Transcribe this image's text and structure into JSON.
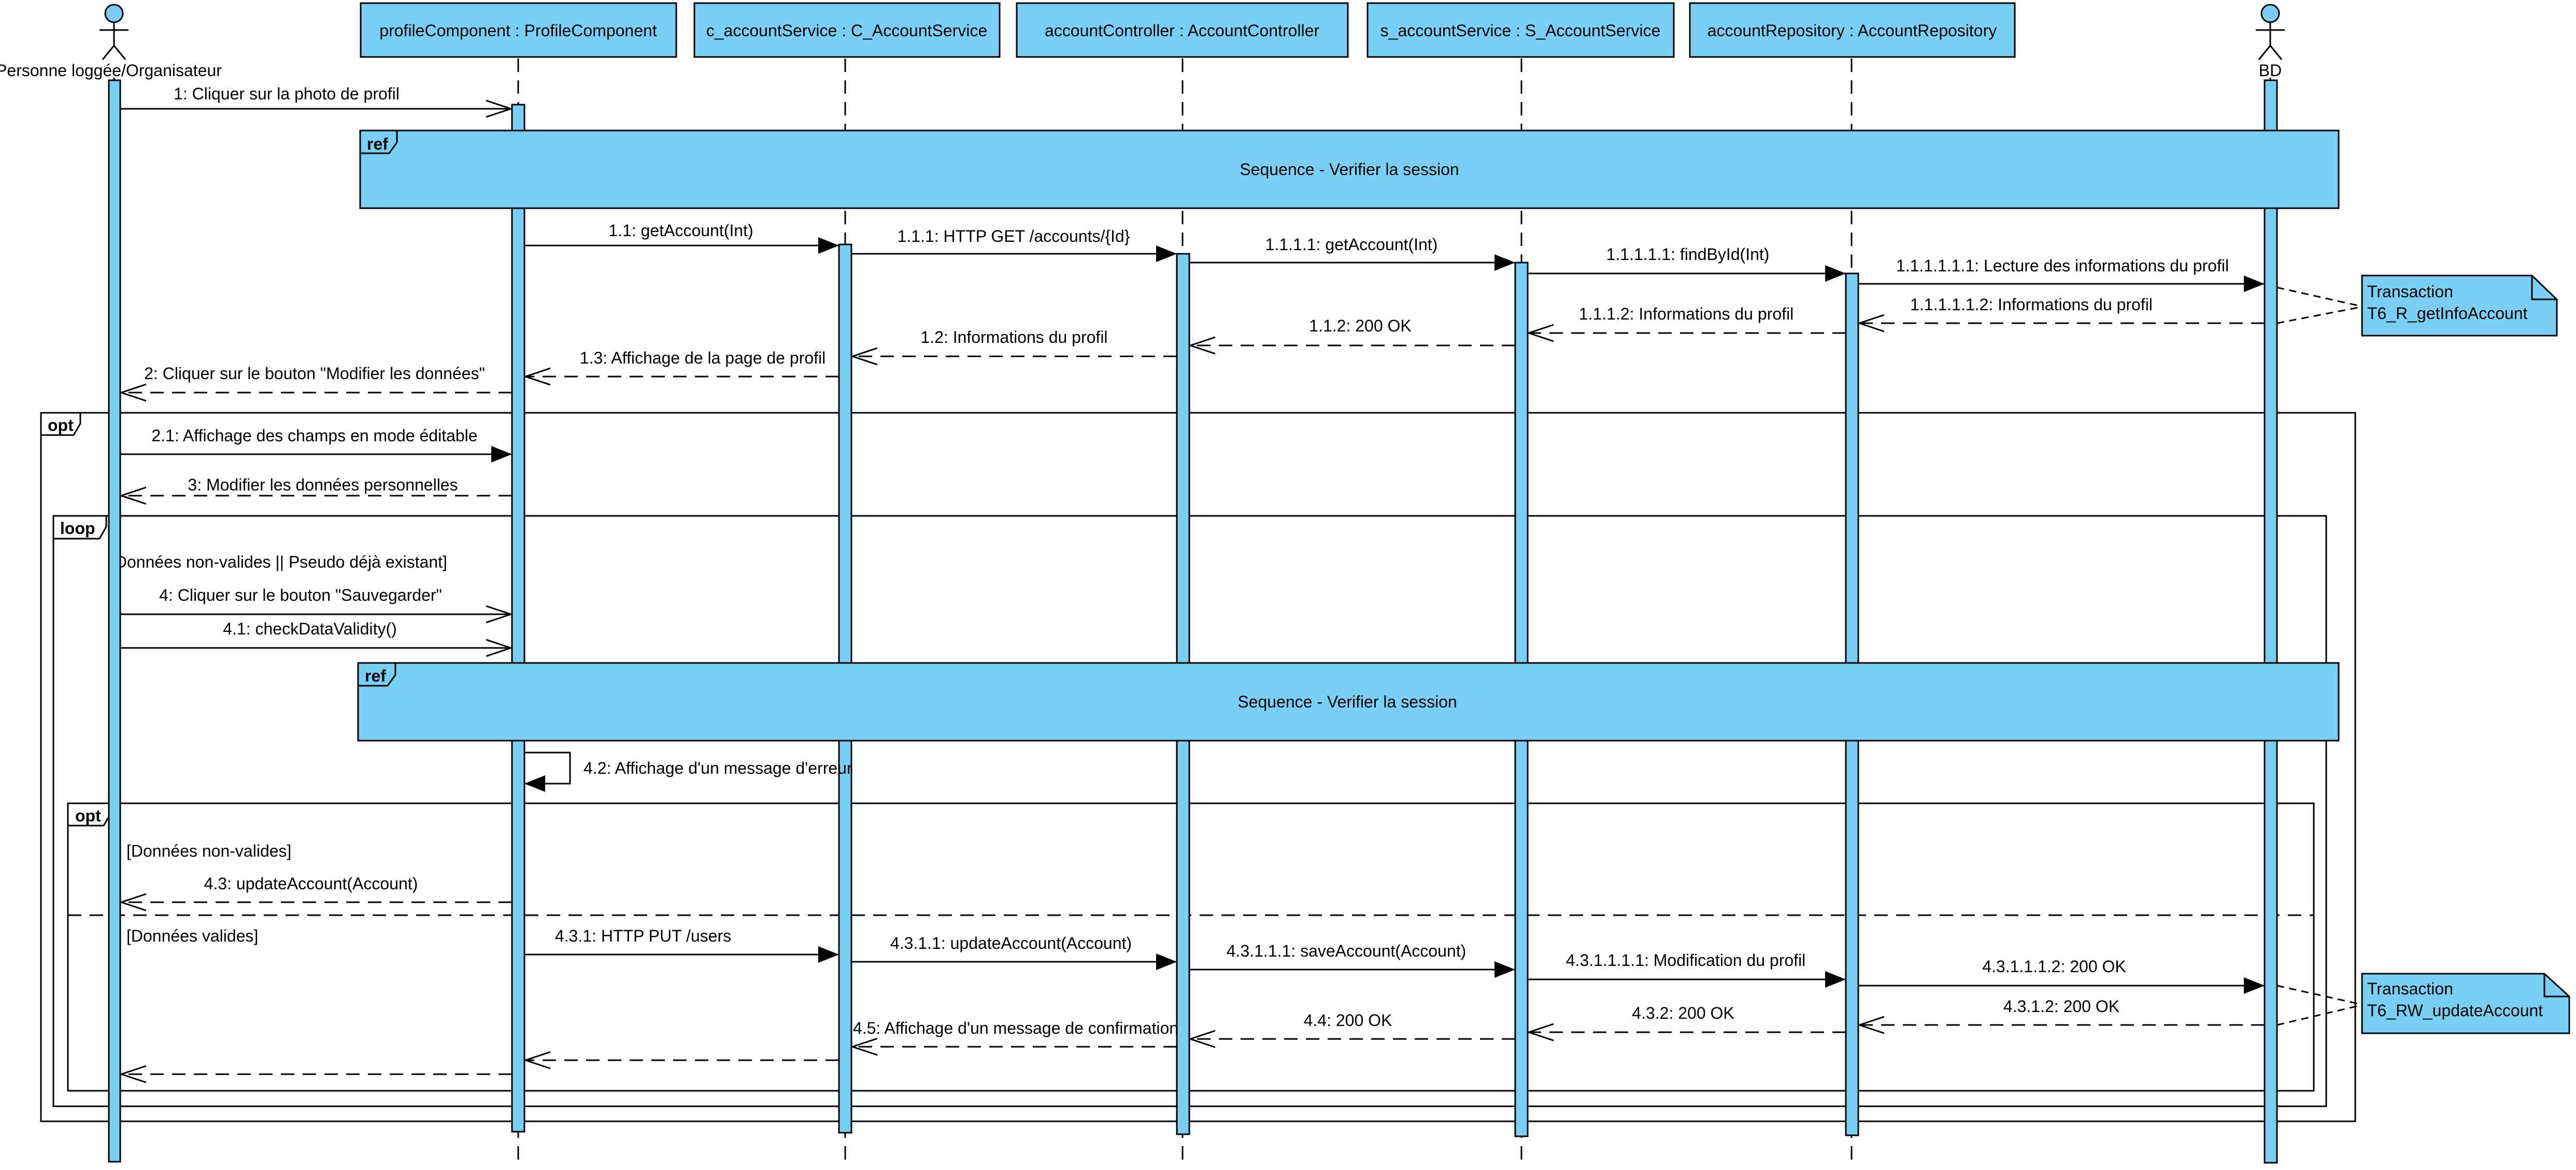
{
  "colors": {
    "fill": "#7acff5",
    "stroke": "#000000",
    "note_fill": "#7acff5",
    "background": "#ffffff"
  },
  "actors": [
    {
      "id": "user",
      "label": "Personne loggée/Organisateur",
      "kind": "actor"
    },
    {
      "id": "profile",
      "label": "profileComponent : ProfileComponent",
      "kind": "object"
    },
    {
      "id": "cservice",
      "label": "c_accountService : C_AccountService",
      "kind": "object"
    },
    {
      "id": "controller",
      "label": "accountController : AccountController",
      "kind": "object"
    },
    {
      "id": "sservice",
      "label": "s_accountService : S_AccountService",
      "kind": "object"
    },
    {
      "id": "repo",
      "label": "accountRepository : AccountRepository",
      "kind": "object"
    },
    {
      "id": "bd",
      "label": "BD",
      "kind": "actor"
    }
  ],
  "fragments": {
    "ref1": {
      "tag": "ref",
      "text": "Sequence - Verifier la session"
    },
    "ref2": {
      "tag": "ref",
      "text": "Sequence - Verifier la session"
    },
    "opt_outer": {
      "tag": "opt"
    },
    "loop": {
      "tag": "loop",
      "guard": "[Données non-valides || Pseudo déjà existant]"
    },
    "opt_inner": {
      "tag": "opt",
      "guard1": "[Données non-valides]",
      "guard2": "[Données valides]"
    }
  },
  "notes": [
    {
      "id": "note1",
      "line1": "Transaction",
      "line2": "T6_R_getInfoAccount"
    },
    {
      "id": "note2",
      "line1": "Transaction",
      "line2": "T6_RW_updateAccount"
    }
  ],
  "messages": [
    {
      "id": "m1",
      "label": "1: Cliquer sur la photo de profil"
    },
    {
      "id": "m1_1",
      "label": "1.1: getAccount(Int)"
    },
    {
      "id": "m1_1_1",
      "label": "1.1.1: HTTP GET /accounts/{Id}"
    },
    {
      "id": "m1_1_1_1",
      "label": "1.1.1.1: getAccount(Int)"
    },
    {
      "id": "m1_1_1_1_1",
      "label": "1.1.1.1.1: findById(Int)"
    },
    {
      "id": "m1_1_1_1_1_1",
      "label": "1.1.1.1.1.1: Lecture des informations du profil"
    },
    {
      "id": "m1_1_1_1_1_2",
      "label": "1.1.1.1.1.2: Informations du profil"
    },
    {
      "id": "m1_1_1_2",
      "label": "1.1.1.2: Informations du profil"
    },
    {
      "id": "m1_1_2",
      "label": "1.1.2: 200 OK"
    },
    {
      "id": "m1_2",
      "label": "1.2: Informations du profil"
    },
    {
      "id": "m1_3",
      "label": "1.3: Affichage de la page de profil"
    },
    {
      "id": "m2",
      "label": "2: Cliquer sur le bouton \"Modifier les données\""
    },
    {
      "id": "m2_1",
      "label": "2.1: Affichage des champs en mode éditable"
    },
    {
      "id": "m3",
      "label": "3: Modifier les données personnelles"
    },
    {
      "id": "m4",
      "label": "4: Cliquer sur le bouton \"Sauvegarder\""
    },
    {
      "id": "m4_1",
      "label": "4.1: checkDataValidity()"
    },
    {
      "id": "m4_2",
      "label": "4.2: Affichage d'un message d'erreur"
    },
    {
      "id": "m4_3",
      "label": "4.3: updateAccount(Account)"
    },
    {
      "id": "m4_3_1",
      "label": "4.3.1: HTTP PUT /users"
    },
    {
      "id": "m4_3_1_1",
      "label": "4.3.1.1: updateAccount(Account)"
    },
    {
      "id": "m4_3_1_1_1",
      "label": "4.3.1.1.1: saveAccount(Account)"
    },
    {
      "id": "m4_3_1_1_1_1",
      "label": "4.3.1.1.1.1: Modification du profil"
    },
    {
      "id": "m4_3_1_1_1_2",
      "label": "4.3.1.1.1.2: 200 OK"
    },
    {
      "id": "m4_3_1_2",
      "label": "4.3.1.2: 200 OK"
    },
    {
      "id": "m4_3_2",
      "label": "4.3.2: 200 OK"
    },
    {
      "id": "m4_4",
      "label": "4.4: 200 OK"
    },
    {
      "id": "m4_5",
      "label": "4.5: Affichage d'un message de confirmation"
    }
  ]
}
